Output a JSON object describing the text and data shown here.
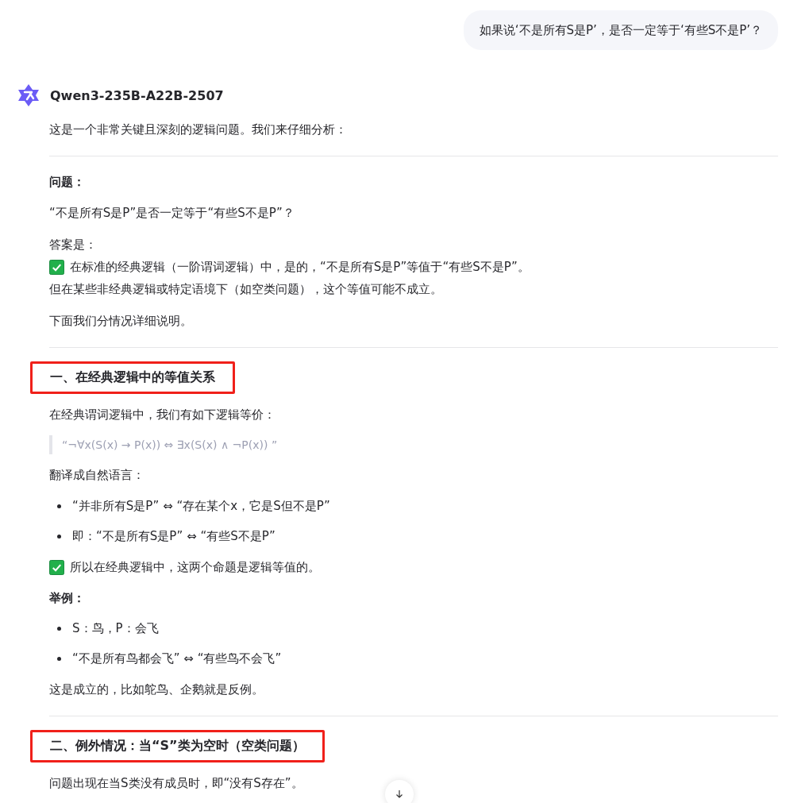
{
  "user_message": "如果说‘不是所有S是P’，是否一定等于‘有些S不是P’？",
  "assistant": {
    "name": "Qwen3-235B-A22B-2507",
    "blocks": [
      {
        "kind": "para",
        "lines": [
          {
            "text": "这是一个非常关键且深刻的逻辑问题。我们来仔细分析：",
            "check": false
          }
        ]
      },
      {
        "kind": "rule"
      },
      {
        "kind": "strong",
        "text": "问题："
      },
      {
        "kind": "para",
        "lines": [
          {
            "text": "“不是所有S是P”是否一定等于“有些S不是P”？",
            "check": false
          }
        ]
      },
      {
        "kind": "para",
        "lines": [
          {
            "text": "答案是：",
            "check": false
          },
          {
            "text": "在标准的经典逻辑（一阶谓词逻辑）中，是的，“不是所有S是P”等值于“有些S不是P”。",
            "check": true
          },
          {
            "text": "但在某些非经典逻辑或特定语境下（如空类问题），这个等值可能不成立。",
            "check": false
          }
        ]
      },
      {
        "kind": "para",
        "lines": [
          {
            "text": "下面我们分情况详细说明。",
            "check": false
          }
        ]
      },
      {
        "kind": "rule"
      },
      {
        "kind": "heading",
        "text": "一、在经典逻辑中的等值关系",
        "highlighted": true
      },
      {
        "kind": "para",
        "lines": [
          {
            "text": "在经典谓词逻辑中，我们有如下逻辑等价：",
            "check": false
          }
        ]
      },
      {
        "kind": "quote",
        "text": "“¬∀x(S(x) → P(x)) ⇔ ∃x(S(x) ∧ ¬P(x)) ”"
      },
      {
        "kind": "para",
        "lines": [
          {
            "text": "翻译成自然语言：",
            "check": false
          }
        ]
      },
      {
        "kind": "bullet",
        "text": "“并非所有S是P” ⇔ “存在某个x，它是S但不是P”"
      },
      {
        "kind": "bullet",
        "text": "即：“不是所有S是P” ⇔ “有些S不是P”"
      },
      {
        "kind": "para",
        "lines": [
          {
            "text": "所以在经典逻辑中，这两个命题是逻辑等值的。",
            "check": true
          }
        ]
      },
      {
        "kind": "strong",
        "text": "举例："
      },
      {
        "kind": "bullet",
        "text": "S：鸟，P：会飞"
      },
      {
        "kind": "bullet",
        "text": "“不是所有鸟都会飞” ⇔ “有些鸟不会飞”"
      },
      {
        "kind": "para",
        "lines": [
          {
            "text": "这是成立的，比如鸵鸟、企鹅就是反例。",
            "check": false
          }
        ]
      },
      {
        "kind": "rule"
      },
      {
        "kind": "heading",
        "text": "二、例外情况：当“S”类为空时（空类问题）",
        "highlighted": true
      },
      {
        "kind": "para",
        "lines": [
          {
            "text": "问题出现在当S类没有成员时，即“没有S存在”。",
            "check": false
          }
        ]
      }
    ]
  }
}
